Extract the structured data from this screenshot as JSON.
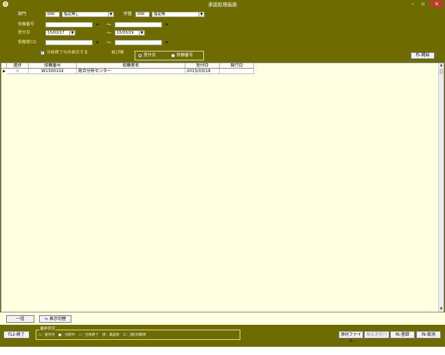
{
  "window": {
    "title": "承認処理画面"
  },
  "filters": {
    "bumon_label": "部門",
    "bumon_code": "000",
    "bumon_value": "指定無し",
    "shokan_label": "所管",
    "shokan_code": "000",
    "shokan_value": "指定無",
    "irai_no_label": "依頼番号",
    "uketsuke_label": "受付日",
    "date_from": "15/02/17",
    "date_to": "15/03/19",
    "iraisha_label": "依頼者CD",
    "tilde": "～",
    "only_finished_label": "分析終了のみ表示する",
    "sort_label": "並び順",
    "sort_options": [
      "受付日",
      "依頼番号"
    ],
    "start_button": "f5-開始"
  },
  "table": {
    "headers": [
      "進捗",
      "依頼番号",
      "依頼者名",
      "受付日",
      "発行日"
    ],
    "rows": [
      {
        "status": "☆",
        "irai_no": "W1300102",
        "name": "総合分析センター",
        "uketsuke": "2015/03/19",
        "hakko": ""
      }
    ]
  },
  "lower": {
    "ikkatsu_button": "一括",
    "toggle_button": "表示切替"
  },
  "footer": {
    "exit_button": "f12-終了",
    "legend_title": "進捗状況",
    "legend_text": "◇：受付中　●：分析中　☆：分析終了　済：承認済　Ｚ：(前)印刷済",
    "attach_button": "添付ファイル",
    "report_button": "報告書受付",
    "register_button": "f6-登録",
    "cancel_button": "f9-取消"
  }
}
